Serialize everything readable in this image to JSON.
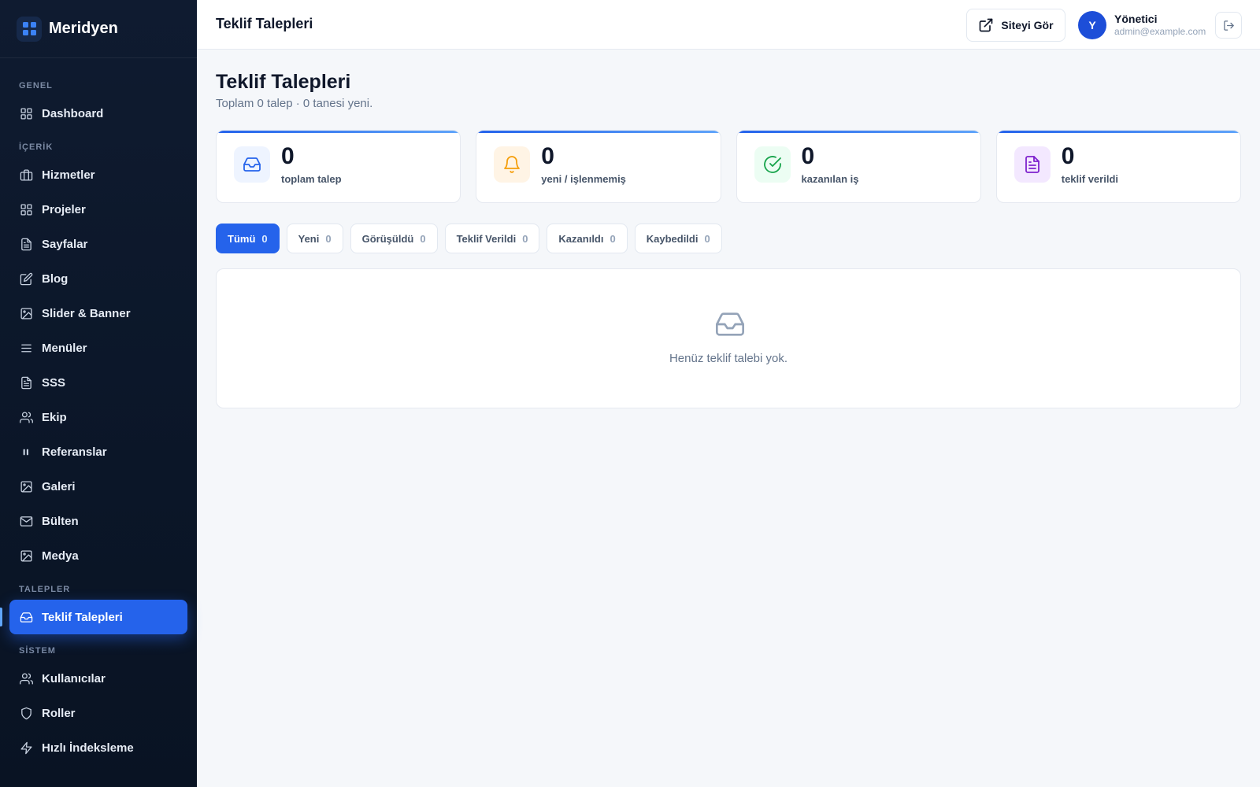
{
  "brand": {
    "name": "Meridyen"
  },
  "sidebar": {
    "sections": [
      {
        "title": "GENEL",
        "items": [
          {
            "label": "Dashboard",
            "icon": "grid-icon"
          }
        ]
      },
      {
        "title": "İÇERİK",
        "items": [
          {
            "label": "Hizmetler",
            "icon": "briefcase-icon"
          },
          {
            "label": "Projeler",
            "icon": "grid-icon"
          },
          {
            "label": "Sayfalar",
            "icon": "file-text-icon"
          },
          {
            "label": "Blog",
            "icon": "edit-icon"
          },
          {
            "label": "Slider & Banner",
            "icon": "image-icon"
          },
          {
            "label": "Menüler",
            "icon": "menu-icon"
          },
          {
            "label": "SSS",
            "icon": "file-text-icon"
          },
          {
            "label": "Ekip",
            "icon": "users-icon"
          },
          {
            "label": "Referanslar",
            "icon": "quote-icon"
          },
          {
            "label": "Galeri",
            "icon": "image-icon"
          },
          {
            "label": "Bülten",
            "icon": "mail-icon"
          },
          {
            "label": "Medya",
            "icon": "image-icon"
          }
        ]
      },
      {
        "title": "TALEPLER",
        "items": [
          {
            "label": "Teklif Talepleri",
            "icon": "inbox-icon",
            "active": true
          }
        ]
      },
      {
        "title": "SİSTEM",
        "items": [
          {
            "label": "Kullanıcılar",
            "icon": "users-icon"
          },
          {
            "label": "Roller",
            "icon": "shield-icon"
          },
          {
            "label": "Hızlı İndeksleme",
            "icon": "zap-icon"
          }
        ]
      }
    ]
  },
  "topbar": {
    "title": "Teklif Talepleri",
    "site_button": "Siteyi Gör",
    "user": {
      "initial": "Y",
      "name": "Yönetici",
      "email": "admin@example.com"
    }
  },
  "page": {
    "title": "Teklif Talepleri",
    "subtitle": "Toplam 0 talep · 0 tanesi yeni."
  },
  "stats": [
    {
      "value": "0",
      "label": "toplam talep",
      "icon": "inbox-icon",
      "color": "#2563eb",
      "bg": "#eef4ff"
    },
    {
      "value": "0",
      "label": "yeni / işlenmemiş",
      "icon": "bell-icon",
      "color": "#f59e0b",
      "bg": "#fff4e5"
    },
    {
      "value": "0",
      "label": "kazanılan iş",
      "icon": "check-circle-icon",
      "color": "#16a34a",
      "bg": "#ecfdf3"
    },
    {
      "value": "0",
      "label": "teklif verildi",
      "icon": "file-text-icon",
      "color": "#7e22ce",
      "bg": "#f3e8ff"
    }
  ],
  "filters": [
    {
      "label": "Tümü",
      "count": "0",
      "active": true
    },
    {
      "label": "Yeni",
      "count": "0"
    },
    {
      "label": "Görüşüldü",
      "count": "0"
    },
    {
      "label": "Teklif Verildi",
      "count": "0"
    },
    {
      "label": "Kazanıldı",
      "count": "0"
    },
    {
      "label": "Kaybedildi",
      "count": "0"
    }
  ],
  "empty_state": {
    "text": "Henüz teklif talebi yok.",
    "icon": "inbox-icon"
  }
}
